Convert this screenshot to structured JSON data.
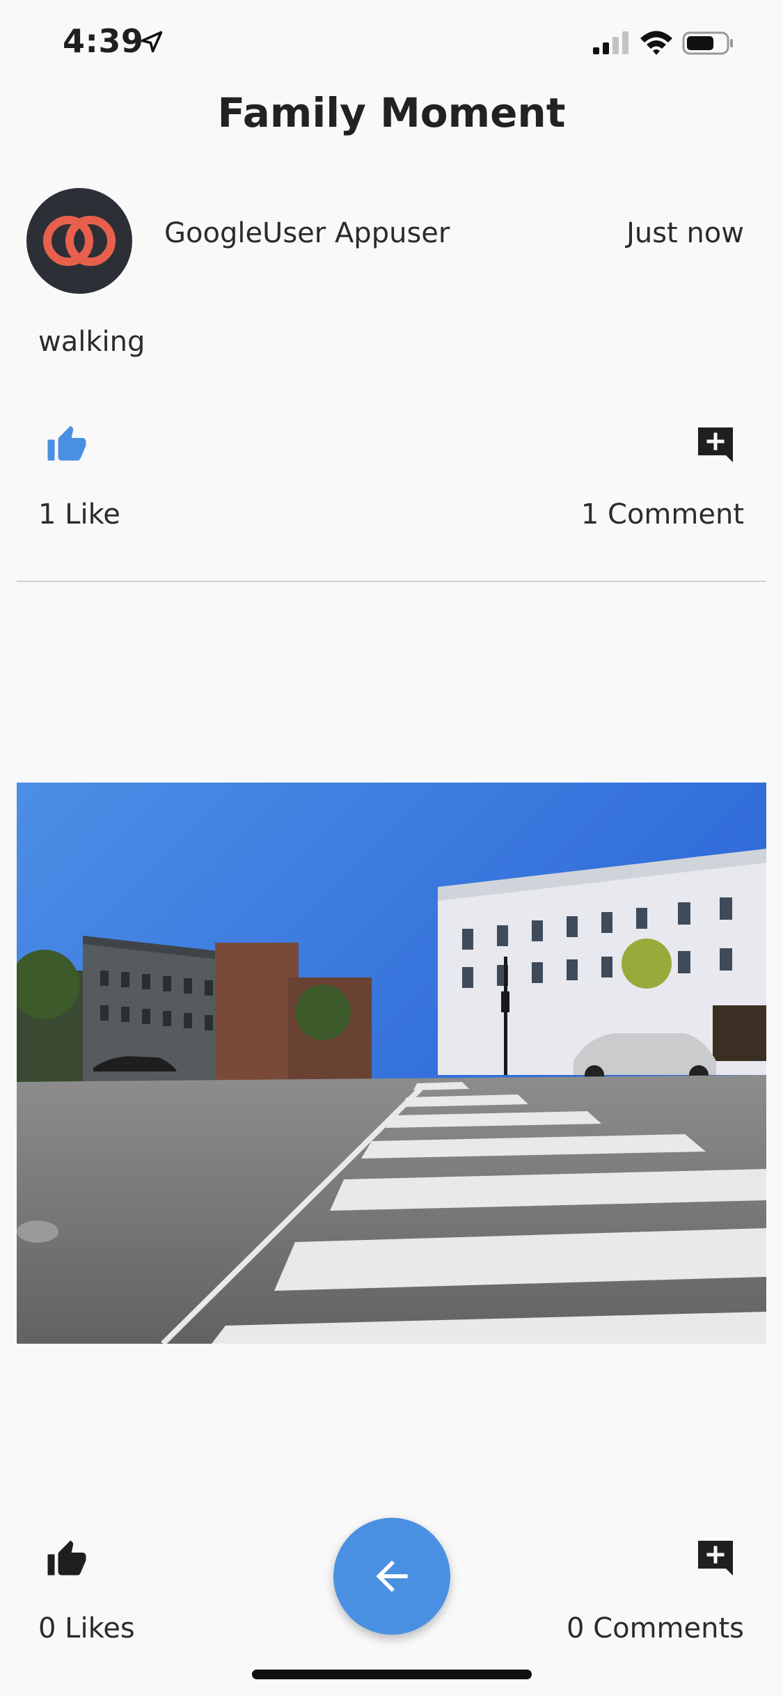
{
  "status_bar": {
    "time": "4:39"
  },
  "header": {
    "title": "Family Moment"
  },
  "post": {
    "author": "GoogleUser Appuser",
    "time": "Just now",
    "text": "walking",
    "likes_label": "1 Like",
    "comments_label": "1 Comment",
    "liked": true
  },
  "photo": {
    "description_icon": "street-photo"
  },
  "footer": {
    "likes_label": "0 Likes",
    "comments_label": "0 Comments"
  },
  "colors": {
    "accent": "#4a90e2",
    "avatar_bg": "#2c3036",
    "avatar_logo": "#e8604c",
    "background": "#f9f9f9"
  }
}
